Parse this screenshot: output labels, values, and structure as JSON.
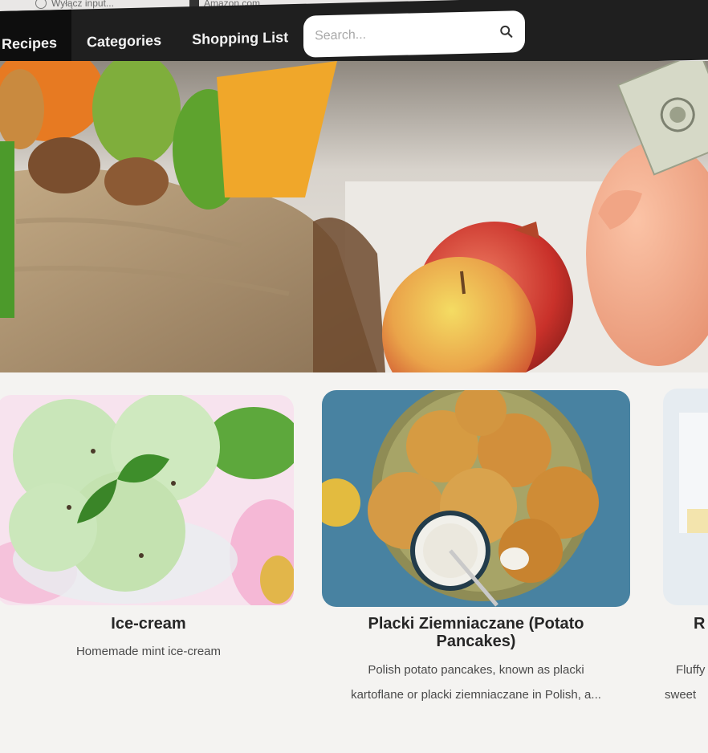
{
  "bookmarks": [
    {
      "icon": "openai-icon",
      "label": "Wyłącz input..."
    },
    {
      "icon": "amazon-icon",
      "label": "Amazon.com"
    }
  ],
  "nav": {
    "items": [
      {
        "label": "Recipes",
        "active": true
      },
      {
        "label": "Categories",
        "active": false
      },
      {
        "label": "Shopping List",
        "active": false
      }
    ],
    "search_placeholder": "Search...",
    "search_icon": "search-icon"
  },
  "hero": {
    "image": "groceries-and-piggy-bank-photo"
  },
  "recipes": [
    {
      "title": "Ice-cream",
      "description": "Homemade mint ice-cream",
      "image": "mint-ice-cream-photo"
    },
    {
      "title": "Placki Ziemniaczane (Potato Pancakes)",
      "description_lines": [
        "Polish potato pancakes, known as placki",
        "kartoflane or placki ziemniaczane in Polish, a..."
      ],
      "image": "potato-pancakes-photo"
    },
    {
      "title": "R",
      "description_lines": [
        "Fluffy",
        "sweet"
      ],
      "image": "partial-recipe-photo"
    }
  ],
  "colors": {
    "navbar": "#1f1f1f",
    "navbar_active": "#0e0e0e",
    "nav_text": "#f2f2f2",
    "page_bg": "#f4f3f1"
  }
}
